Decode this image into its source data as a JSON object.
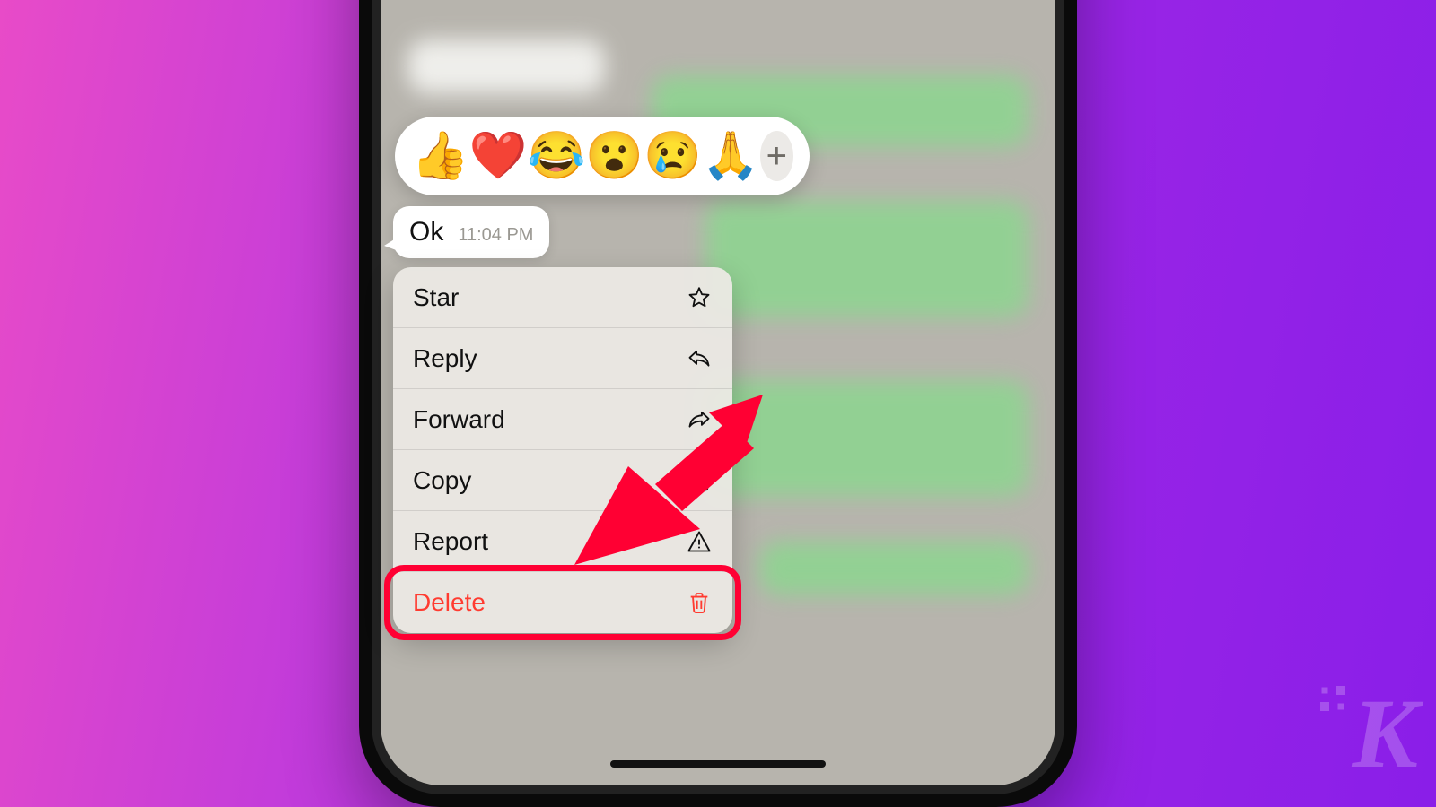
{
  "reactions": {
    "items": [
      "👍",
      "❤️",
      "😂",
      "😮",
      "😢",
      "🙏"
    ],
    "add_symbol": "+"
  },
  "message": {
    "text": "Ok",
    "time": "11:04 PM"
  },
  "menu": {
    "items": [
      {
        "label": "Star",
        "icon": "star-icon",
        "destructive": false
      },
      {
        "label": "Reply",
        "icon": "reply-icon",
        "destructive": false
      },
      {
        "label": "Forward",
        "icon": "forward-icon",
        "destructive": false
      },
      {
        "label": "Copy",
        "icon": "copy-icon",
        "destructive": false
      },
      {
        "label": "Report",
        "icon": "warning-icon",
        "destructive": false
      },
      {
        "label": "Delete",
        "icon": "trash-icon",
        "destructive": true
      }
    ]
  },
  "annotation": {
    "arrow_color": "#ff0033",
    "highlight_target": "Delete"
  },
  "watermark": {
    "text": "K"
  }
}
